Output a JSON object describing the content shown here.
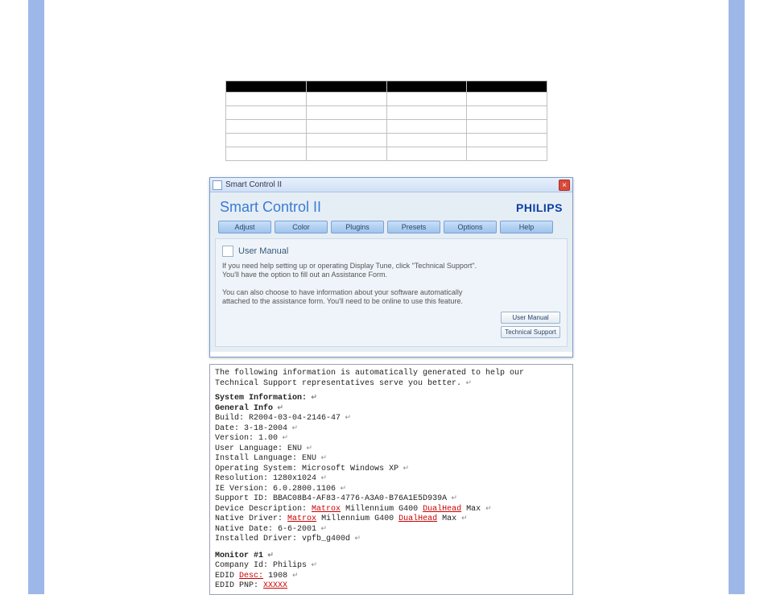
{
  "window": {
    "titlebar": "Smart Control II",
    "close_glyph": "×",
    "app_name": "Smart Control II",
    "brand": "PHILIPS",
    "tabs": [
      "Adjust",
      "Color",
      "Plugins",
      "Presets",
      "Options",
      "Help"
    ],
    "panel": {
      "title": "User Manual",
      "p1": "If you need help setting up or operating Display Tune, click \"Technical Support\". You'll have the option to fill out an Assistance Form.",
      "p2": "You can also choose to have information about your software automatically attached to the assistance form. You'll need to be online to use this feature.",
      "btn_manual": "User Manual",
      "btn_support": "Technical Support"
    }
  },
  "sysinfo": {
    "intro": "The following information is automatically generated to help our Technical Support representatives serve you better.",
    "section1": "System Information:",
    "general": "General Info",
    "build_label": "Build:",
    "build_value": "R2004-03-04-2146-47",
    "date_label": "Date:",
    "date_value": "3-18-2004",
    "version_label": "Version:",
    "version_value": "1.00",
    "userlang_label": "User Language:",
    "userlang_value": "ENU",
    "instlang_label": "Install Language:",
    "instlang_value": "ENU",
    "os_label": "Operating System:",
    "os_value": "Microsoft Windows XP",
    "res_label": "Resolution:",
    "res_value": "1280x1024",
    "ie_label": "IE Version:",
    "ie_value": "6.0.2800.1106",
    "support_label": "Support ID:",
    "support_value": "BBAC08B4-AF83-4776-A3A0-B76A1E5D939A",
    "devdesc_label": "Device Description:",
    "devdesc_word1": "Matrox",
    "devdesc_rest": "Millennium G400",
    "devdesc_word2": "DualHead",
    "devdesc_tail": "Max",
    "native_drv_label": "Native Driver:",
    "native_date_label": "Native Date:",
    "native_date_value": "6-6-2001",
    "inst_drv_label": "Installed Driver:",
    "inst_drv_value": "vpfb_g400d",
    "monitor_hdr": "Monitor #1",
    "company_label": "Company Id:",
    "company_value": "Philips",
    "edid_desc_label": "EDID",
    "edid_desc_word": "Desc:",
    "edid_desc_value": "1908",
    "edid_pnp_label": "EDID PNP:",
    "edid_pnp_value": "XXXXX"
  }
}
